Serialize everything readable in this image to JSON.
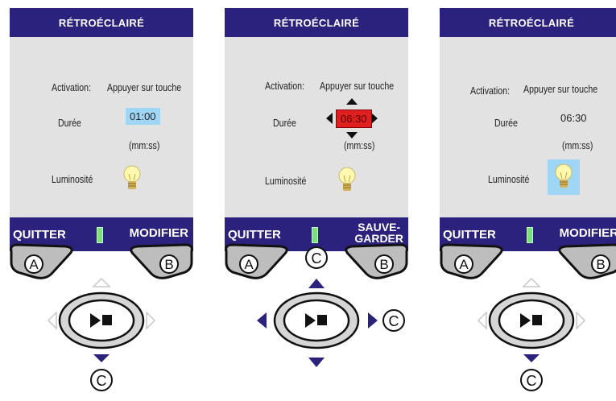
{
  "panels": [
    {
      "title": "RÉTROÉCLAIRÉ",
      "activation_label": "Activation:",
      "activation_value": "Appuyer sur touche",
      "duration_label": "Durée",
      "duration_value": "01:00",
      "duration_state": "selected",
      "unit": "(mm:ss)",
      "brightness_label": "Luminosité",
      "brightness_state": "normal",
      "softkey_left": "QUITTER",
      "softkey_right": "MODIFIER",
      "keys": {
        "a": "A",
        "b": "B",
        "c": "C"
      },
      "arrows_active": [
        "down"
      ]
    },
    {
      "title": "RÉTROÉCLAIRÉ",
      "activation_label": "Activation:",
      "activation_value": "Appuyer sur touche",
      "duration_label": "Durée",
      "duration_value": "06:30",
      "duration_state": "editing",
      "unit": "(mm:ss)",
      "brightness_label": "Luminosité",
      "brightness_state": "normal",
      "softkey_left": "QUITTER",
      "softkey_right_line1": "SAUVE-",
      "softkey_right_line2": "GARDER",
      "keys": {
        "a": "A",
        "b": "B",
        "c_up": "C",
        "c_right": "C"
      },
      "arrows_active": [
        "up",
        "down",
        "left",
        "right"
      ]
    },
    {
      "title": "RÉTROÉCLAIRÉ",
      "activation_label": "Activation:",
      "activation_value": "Appuyer sur touche",
      "duration_label": "Durée",
      "duration_value": "06:30",
      "duration_state": "normal",
      "unit": "(mm:ss)",
      "brightness_label": "Luminosité",
      "brightness_state": "selected",
      "softkey_left": "QUITTER",
      "softkey_right": "MODIFIER",
      "keys": {
        "a": "A",
        "b": "B",
        "c": "C"
      },
      "arrows_active": [
        "down"
      ]
    }
  ],
  "colors": {
    "navy": "#2a227d",
    "screen_bg": "#e2e2e2",
    "highlight_blue": "#9fd6f5",
    "edit_red": "#e01f1f",
    "separator_green": "#7be07b"
  },
  "icons": [
    "lightbulb-icon",
    "play-pause-icon",
    "triangle-arrow-icon"
  ]
}
